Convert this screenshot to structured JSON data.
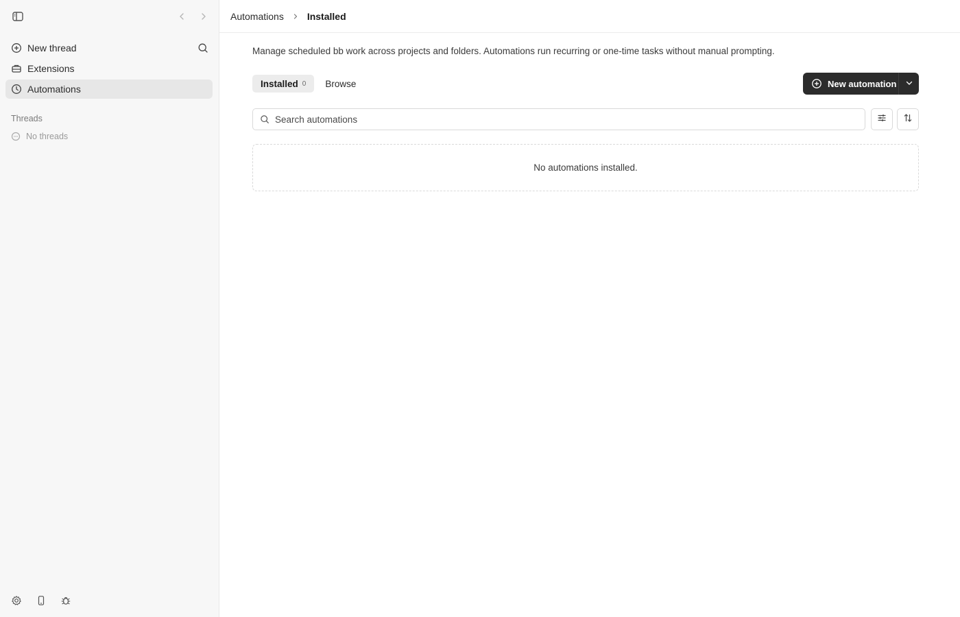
{
  "sidebar": {
    "items": [
      {
        "id": "new-thread",
        "label": "New thread",
        "icon": "plus-circle-icon",
        "active": false
      },
      {
        "id": "extensions",
        "label": "Extensions",
        "icon": "toolbox-icon",
        "active": false
      },
      {
        "id": "automations",
        "label": "Automations",
        "icon": "clock-icon",
        "active": true
      }
    ],
    "threads_section_label": "Threads",
    "empty_threads_label": "No threads",
    "bottom_tools": [
      "gear-icon",
      "mobile-icon",
      "bug-icon"
    ]
  },
  "breadcrumb": {
    "parent": "Automations",
    "current": "Installed"
  },
  "page": {
    "description": "Manage scheduled bb work across projects and folders. Automations run recurring or one-time tasks without manual prompting.",
    "tabs": [
      {
        "label": "Installed",
        "count": "0",
        "active": true
      },
      {
        "label": "Browse",
        "count": "",
        "active": false
      }
    ],
    "new_button_label": "New automation",
    "search": {
      "placeholder": "Search automations",
      "value": ""
    },
    "empty_message": "No automations installed."
  },
  "colors": {
    "sidebar_bg": "#f7f7f7",
    "active_item_bg": "#e7e7e7",
    "primary_button_bg": "#2c2c2c",
    "border": "#d9d9d9"
  }
}
